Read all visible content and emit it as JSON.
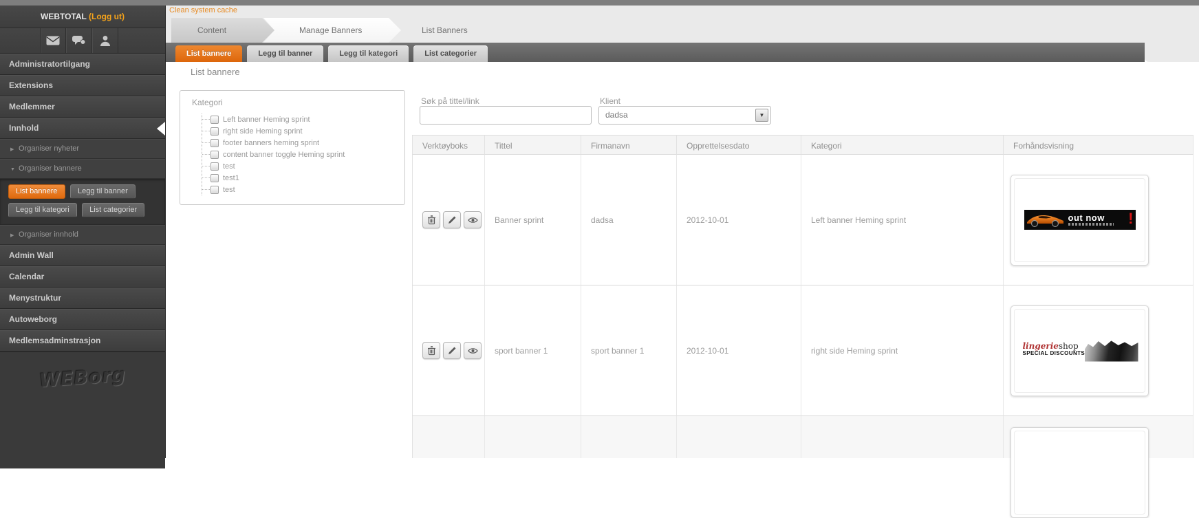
{
  "topbar": {
    "cache_link": "Clean system cache"
  },
  "sidebar": {
    "brand": "WEBTOTAL",
    "logout": "(Logg ut)",
    "menu": [
      "Administratortilgang",
      "Extensions",
      "Medlemmer",
      "Innhold"
    ],
    "submenu": {
      "nyheter": "Organiser nyheter",
      "bannere": "Organiser bannere",
      "innhold": "Organiser innhold"
    },
    "banner_buttons": [
      "List bannere",
      "Legg til banner",
      "Legg til kategori",
      "List categorier"
    ],
    "menu2": [
      "Admin Wall",
      "Calendar",
      "Menystruktur",
      "Autoweborg",
      "Medlemsadminstrasjon"
    ],
    "watermark": "WEBorg"
  },
  "breadcrumb": [
    "Content",
    "Manage Banners",
    "List Banners"
  ],
  "tabs": [
    "List bannere",
    "Legg til banner",
    "Legg til kategori",
    "List categorier"
  ],
  "page": {
    "title": "List bannere"
  },
  "filters": {
    "kategori_label": "Kategori",
    "tree": [
      "Left banner Heming sprint",
      "right side Heming sprint",
      "footer banners heming sprint",
      "content banner toggle Heming sprint",
      "test",
      "test1",
      "test"
    ],
    "search_label": "Søk på tittel/link",
    "search_value": "",
    "klient_label": "Klient",
    "klient_value": "dadsa"
  },
  "table": {
    "headers": [
      "Verktøyboks",
      "Tittel",
      "Firmanavn",
      "Opprettelsesdato",
      "Kategori",
      "Forhåndsvisning"
    ],
    "rows": [
      {
        "tittel": "Banner sprint",
        "firmanavn": "dadsa",
        "dato": "2012-10-01",
        "kategori": "Left banner Heming sprint"
      },
      {
        "tittel": "sport banner 1",
        "firmanavn": "sport banner 1",
        "dato": "2012-10-01",
        "kategori": "right side Heming sprint"
      }
    ]
  },
  "previews": {
    "banner1": {
      "headline": "out now",
      "exclaim": "!"
    },
    "banner2": {
      "brand_script": "lingerie",
      "brand_rest": "shop",
      "tagline": "SPECIAL DISCOUNTS"
    }
  },
  "colors": {
    "accent_orange": "#dd660b",
    "link_orange": "#e8891f"
  }
}
